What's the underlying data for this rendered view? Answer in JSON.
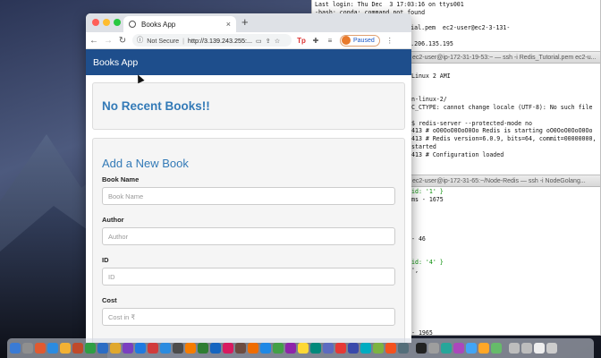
{
  "terminal_top": {
    "lines": [
      "Last login: Thu Dec  3 17:03:16 on ttys001",
      "-bash: conda: command not found",
      "         Downloads",
      "         ssh -i Redis_Tutorial.pem  ec2-user@ec2-3-131-",
      "         onaws.com",
      "         c  4 2020 from 103.206.135.195"
    ]
  },
  "terminal_mid": {
    "title": "ec2-user@ip-172-31-19-53:~ — ssh -i Redis_Tutorial.pem ec2-u...",
    "lines": [
      "",
      "Linux 2 AMI",
      "",
      "",
      "n-linux-2/",
      "C_CTYPE: cannot change locale (UTF-8): No such file",
      "",
      "$ redis-server --protected-mode no",
      "413 # oO0OoO0OoO0Oo Redis is starting oO0OoO0OoO0Oo",
      "413 # Redis version=6.0.9, bits=64, commit=00000000,",
      "started",
      "413 # Configuration loaded",
      "",
      "",
      "         Redis 6.0.9 (00000000/0) 64 bit",
      "",
      "',     )    Running in standalone mode",
      "_.-'|     Port: 6379"
    ]
  },
  "terminal_bottom": {
    "title": "ec2-user@ip-172-31-65:~/Node-Redis — ssh -i NodeGolang...",
    "lines": [
      "id: '1' }",
      "ms - 1675",
      "",
      "",
      "",
      "",
      "- 46",
      "",
      "",
      "id: '4' }",
      "',",
      "",
      "",
      "",
      "",
      "",
      "",
      "",
      "- 1965",
      "",
      "",
      "",
      "36 ms - 58"
    ]
  },
  "browser": {
    "tab_title": "Books App",
    "tab_close": "×",
    "new_tab": "+",
    "security_label": "Not Secure",
    "url": "http://3.139.243.255:...",
    "profile_label": "Paused"
  },
  "app": {
    "title": "Books App",
    "recent_heading": "No Recent Books!!",
    "form_heading": "Add a New Book",
    "fields": [
      {
        "label": "Book Name",
        "placeholder": "Book Name"
      },
      {
        "label": "Author",
        "placeholder": "Author"
      },
      {
        "label": "ID",
        "placeholder": "ID"
      },
      {
        "label": "Cost",
        "placeholder": "Cost in ₹"
      }
    ]
  },
  "dock_colors": [
    "#3a7bd5",
    "#8f8f8f",
    "#e05a30",
    "#2b8be0",
    "#f2b134",
    "#c04a2a",
    "#2f9e44",
    "#2b6cc4",
    "#e0a82e",
    "#7a3fc0",
    "#1f7ae0",
    "#d13b3b",
    "#2b8be0",
    "#4c4c4c",
    "#f57c00",
    "#2e7d32",
    "#1565c0",
    "#d81b60",
    "#6d4c41",
    "#ef6c00",
    "#1e88e5",
    "#43a047",
    "#8e24aa",
    "#fdd835",
    "#00897b",
    "#5c6bc0",
    "#e53935",
    "#3949ab",
    "#00acc1",
    "#7cb342",
    "#f4511e",
    "#546e7a",
    "#222222",
    "#9e9e9e",
    "#26a69a",
    "#ab47bc",
    "#42a5f5",
    "#ffa726",
    "#66bb6a",
    "#bdbdbd",
    "#bdbdbd",
    "#eeeeee",
    "#cccccc"
  ]
}
